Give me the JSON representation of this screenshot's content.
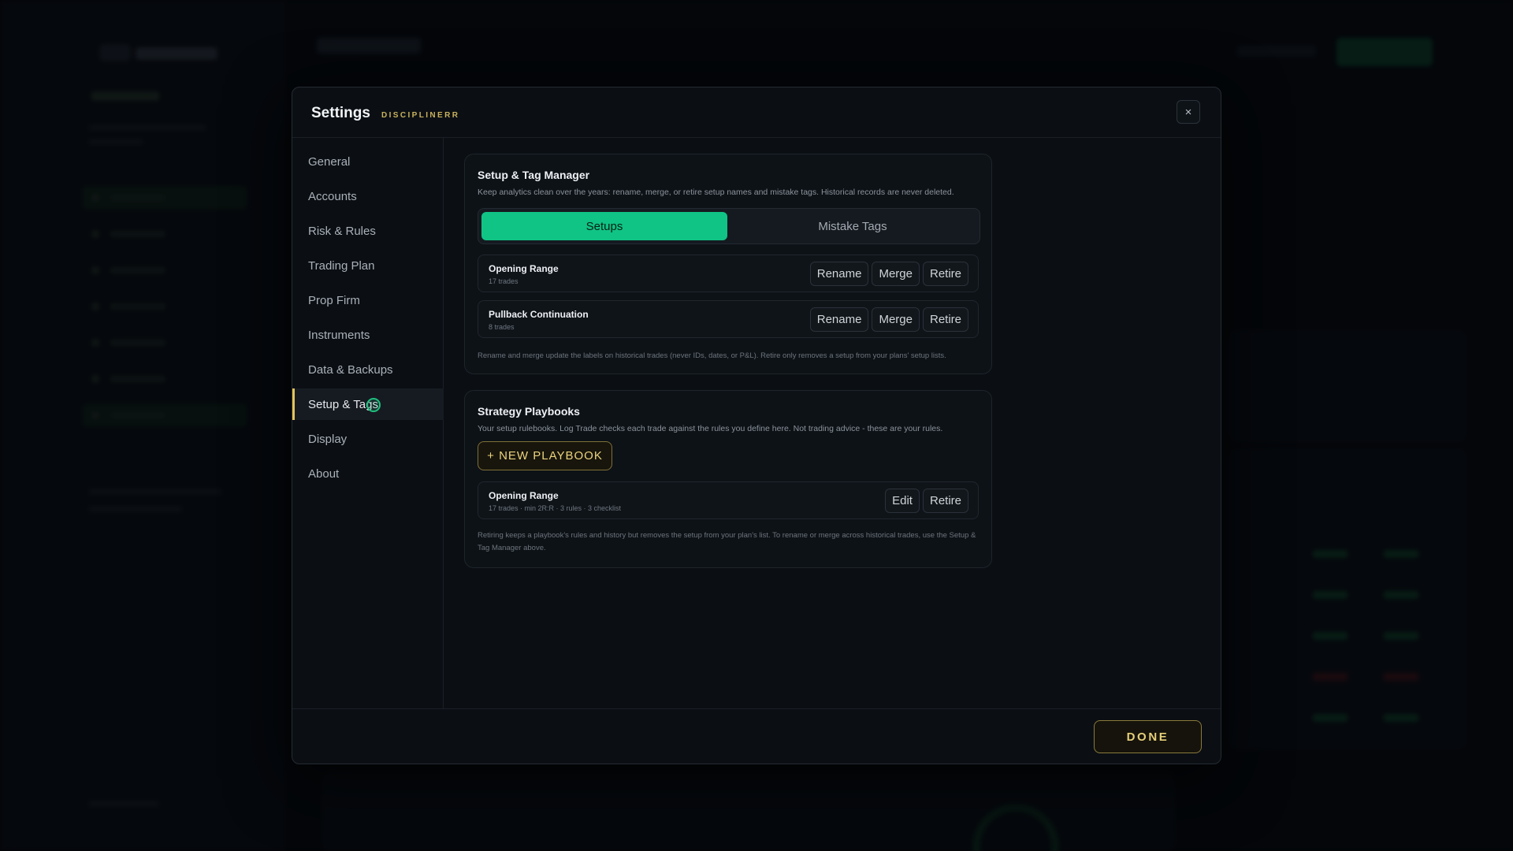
{
  "modal": {
    "title": "Settings",
    "brand": "DISCIPLINERR",
    "close_icon": "×",
    "done_label": "DONE"
  },
  "nav": {
    "items": [
      {
        "label": "General"
      },
      {
        "label": "Accounts"
      },
      {
        "label": "Risk & Rules"
      },
      {
        "label": "Trading Plan"
      },
      {
        "label": "Prop Firm"
      },
      {
        "label": "Instruments"
      },
      {
        "label": "Data & Backups"
      },
      {
        "label": "Setup & Tags"
      },
      {
        "label": "Display"
      },
      {
        "label": "About"
      }
    ],
    "active": "Setup & Tags"
  },
  "tag_manager": {
    "title": "Setup & Tag Manager",
    "description": "Keep analytics clean over the years: rename, merge, or retire setup names and mistake tags. Historical records are never deleted.",
    "tabs": {
      "setups": "Setups",
      "mistake_tags": "Mistake Tags"
    },
    "active_tab": "Setups",
    "rows": [
      {
        "name": "Opening Range",
        "meta": "17 trades",
        "rename": "Rename",
        "merge": "Merge",
        "retire": "Retire"
      },
      {
        "name": "Pullback Continuation",
        "meta": "8 trades",
        "rename": "Rename",
        "merge": "Merge",
        "retire": "Retire"
      }
    ],
    "note": "Rename and merge update the labels on historical trades (never IDs, dates, or P&L). Retire only removes a setup from your plans' setup lists."
  },
  "playbooks": {
    "title": "Strategy Playbooks",
    "description": "Your setup rulebooks. Log Trade checks each trade against the rules you define here. Not trading advice - these are your rules.",
    "new_button": "+ NEW PLAYBOOK",
    "rows": [
      {
        "name": "Opening Range",
        "meta": "17 trades · min 2R:R · 3 rules · 3 checklist",
        "edit": "Edit",
        "retire": "Retire"
      }
    ],
    "note": "Retiring keeps a playbook's rules and history but removes the setup from your plan's list. To rename or merge across historical trades, use the Setup & Tag Manager above."
  },
  "colors": {
    "accent_green": "#10c485",
    "accent_gold": "#e2c458"
  }
}
